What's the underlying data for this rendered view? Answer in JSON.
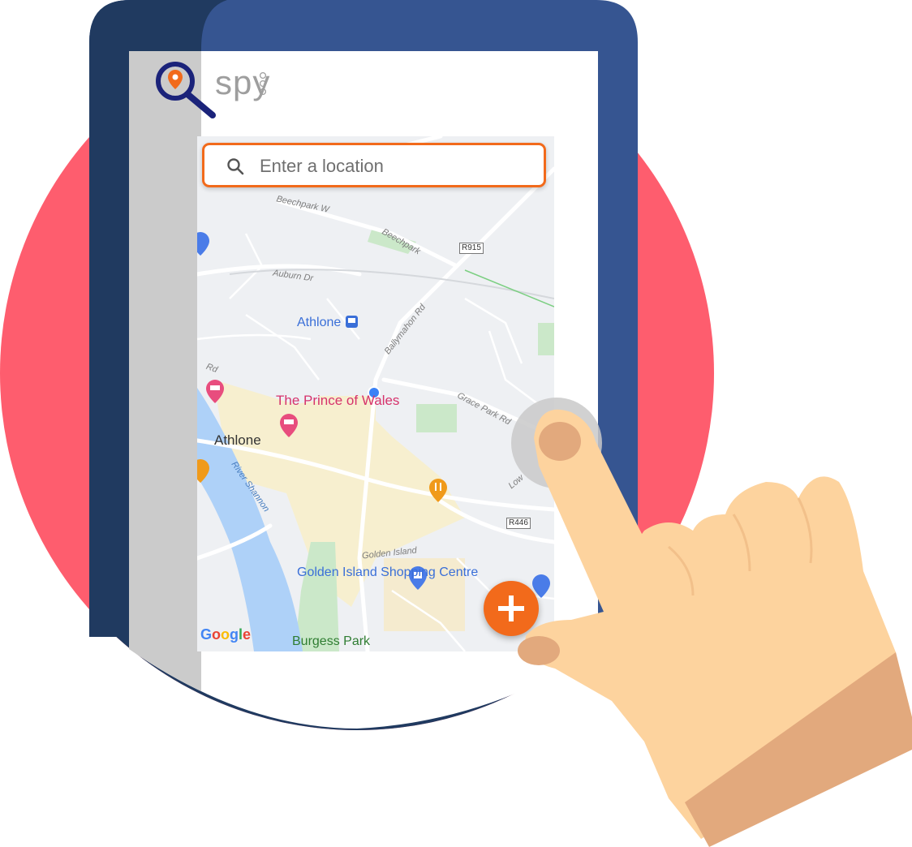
{
  "brand": {
    "name": "spy",
    "logo_icon": "location-magnifier-icon"
  },
  "search": {
    "placeholder": "Enter a location",
    "icon": "search-icon",
    "accent": "#f26a1b"
  },
  "map": {
    "roads": [
      "Beechpark W",
      "Beechpark",
      "Auburn Dr",
      "Ballymahon Rd",
      "Grace Park Rd",
      "Golden Island",
      "Low",
      "Rd",
      "R915",
      "R446"
    ],
    "places": {
      "station": "Athlone",
      "hotel": "The Prince of Wales",
      "town": "Athlone",
      "river": "River Shannon",
      "shopping": "Golden Island Shopping Centre",
      "park": "Burgess Park"
    },
    "attribution": "Google"
  },
  "fab": {
    "icon": "plus-icon",
    "color": "#f26a1b"
  },
  "colors": {
    "backdrop_circle": "#fe5d6e",
    "device_frame": "#365591",
    "device_frame_dark": "#203a60"
  }
}
